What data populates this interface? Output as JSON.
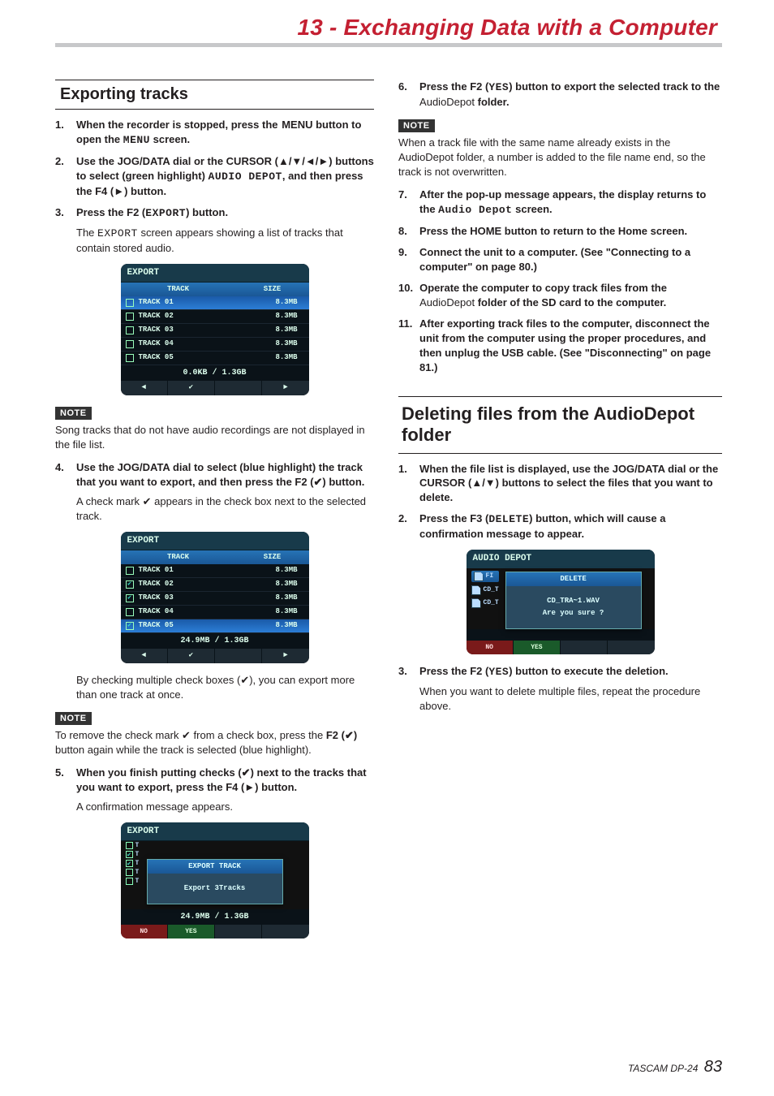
{
  "chapter": "13 - Exchanging Data with a Computer",
  "footer": {
    "model": "TASCAM DP-24",
    "page": "83"
  },
  "left": {
    "section_title": " Exporting tracks",
    "s1": {
      "num": "1.",
      "text_a": "When the recorder is stopped, press the  MENU button to open the ",
      "menu": "MENU",
      "text_b": " screen."
    },
    "s2": {
      "num": "2.",
      "text_a": "Use the JOG/DATA dial or the CURSOR (▲/▼/◄/►) buttons to select (green highlight) ",
      "audio_depot": "AUDIO DEPOT",
      "text_b": ", and then press the F4 (►) button."
    },
    "s3": {
      "num": "3.",
      "text_a": "Press the F2 (",
      "export": "EXPORT",
      "text_b": ") button."
    },
    "s3_desc_a": "The ",
    "s3_desc_mono": "EXPORT",
    "s3_desc_b": " screen appears showing a list of tracks that contain stored audio.",
    "shot1": {
      "title": "EXPORT",
      "header": {
        "track": "TRACK",
        "size": "SIZE"
      },
      "rows": [
        {
          "chk": false,
          "sel": true,
          "track": "TRACK 01",
          "size": "8.3MB"
        },
        {
          "chk": false,
          "sel": false,
          "track": "TRACK 02",
          "size": "8.3MB"
        },
        {
          "chk": false,
          "sel": false,
          "track": "TRACK 03",
          "size": "8.3MB"
        },
        {
          "chk": false,
          "sel": false,
          "track": "TRACK 04",
          "size": "8.3MB"
        },
        {
          "chk": false,
          "sel": false,
          "track": "TRACK 05",
          "size": "8.3MB"
        }
      ],
      "total": "0.0KB /  1.3GB",
      "fkeys": {
        "f1": "◄",
        "f2": "✔",
        "f3": "",
        "f4": "►"
      }
    },
    "note1_tag": "NOTE",
    "note1": "Song tracks that do not have audio recordings are not displayed in the file list.",
    "s4": {
      "num": "4.",
      "text": "Use the JOG/DATA dial to select (blue highlight) the track that you want to export, and then press the F2 (✔) button."
    },
    "s4_desc": "A check mark ✔ appears in the check box next to the selected track.",
    "shot2": {
      "title": "EXPORT",
      "header": {
        "track": "TRACK",
        "size": "SIZE"
      },
      "rows": [
        {
          "chk": false,
          "sel": false,
          "track": "TRACK 01",
          "size": "8.3MB"
        },
        {
          "chk": true,
          "sel": false,
          "track": "TRACK 02",
          "size": "8.3MB"
        },
        {
          "chk": true,
          "sel": false,
          "track": "TRACK 03",
          "size": "8.3MB"
        },
        {
          "chk": false,
          "sel": false,
          "track": "TRACK 04",
          "size": "8.3MB"
        },
        {
          "chk": true,
          "sel": true,
          "track": "TRACK 05",
          "size": "8.3MB"
        }
      ],
      "total": "24.9MB /  1.3GB",
      "fkeys": {
        "f1": "◄",
        "f2": "✔",
        "f3": "",
        "f4": "►"
      }
    },
    "s4_desc2": "By checking multiple check boxes (✔), you can export more than one track at once.",
    "note2_tag": "NOTE",
    "note2_a": "To remove the check mark ✔ from a check box, press the ",
    "note2_b": "F2 (✔)",
    "note2_c": " button again while the track is selected (blue highlight).",
    "s5": {
      "num": "5.",
      "text": "When you finish putting checks (✔) next to the tracks that you want to export, press the F4 (►) button."
    },
    "s5_desc": "A confirmation message appears.",
    "shot3": {
      "title": "EXPORT",
      "left_chk": [
        false,
        true,
        true,
        false,
        false
      ],
      "modal": {
        "head": "EXPORT TRACK",
        "body": "Export 3Tracks",
        "body2": ""
      },
      "total": "24.9MB /  1.3GB",
      "fkeys": {
        "no": "NO",
        "yes": "YES"
      }
    }
  },
  "right": {
    "s6": {
      "num": "6.",
      "text_a": "Press the F2 (",
      "yes": "YES",
      "text_b": ") button to export the selected track to the ",
      "dep": "AudioDepot",
      "text_c": " folder."
    },
    "note3_tag": "NOTE",
    "note3_a": "When a track file with the same name already exists in the ",
    "note3_dep": "AudioDepot",
    "note3_b": " folder, a number is added to the file name end, so the track is not overwritten.",
    "s7": {
      "num": "7.",
      "text_a": "After the pop-up message appears, the display returns to the ",
      "audio_depot": "Audio Depot",
      "text_b": " screen."
    },
    "s8": {
      "num": "8.",
      "text": "Press the HOME button to return to the Home screen."
    },
    "s9": {
      "num": "9.",
      "text": "Connect the unit to a computer. (See \"Connecting to a computer\" on page 80.)"
    },
    "s10": {
      "num": "10.",
      "text_a": "Operate the computer to copy track files from the ",
      "dep": "AudioDepot",
      "text_b": " folder of the SD card to the computer."
    },
    "s11": {
      "num": "11.",
      "text": "After exporting track files to the computer, disconnect the unit from the computer using the proper procedures, and then unplug the USB cable. (See \"Disconnecting\" on page 81.)"
    },
    "section2_title": "Deleting files from the AudioDepot folder",
    "d1": {
      "num": "1.",
      "text": "When the file list is displayed, use the JOG/DATA dial or the CURSOR (▲/▼) buttons to select the files that you want to delete."
    },
    "d2": {
      "num": "2.",
      "text_a": "Press the F3 (",
      "delete": "DELETE",
      "text_b": ") button, which will cause a confirmation message to appear."
    },
    "shot4": {
      "title": "AUDIO DEPOT",
      "left": {
        "fi": "FI",
        "cd1": "CD_T",
        "cd2": "CD_T"
      },
      "modal": {
        "head": "DELETE",
        "body": "CD_TRA~1.WAV",
        "body2": "Are you sure ?"
      },
      "fkeys": {
        "no": "NO",
        "yes": "YES"
      }
    },
    "d3": {
      "num": "3.",
      "text_a": "Press the F2 (",
      "yes": "YES",
      "text_b": ") button to execute the deletion."
    },
    "d3_desc": "When you want to delete multiple files, repeat the procedure above."
  }
}
